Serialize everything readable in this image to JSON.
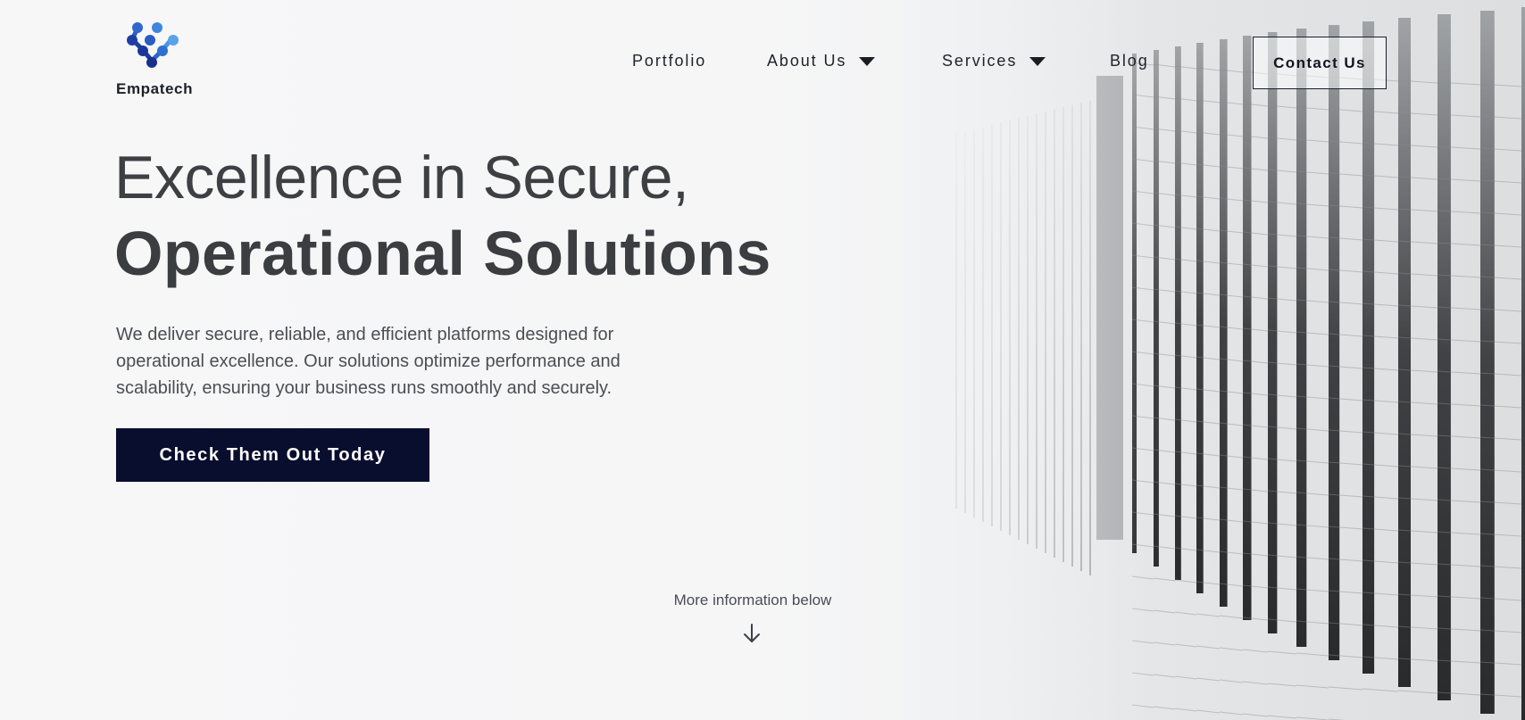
{
  "brand": {
    "name": "Empatech",
    "logo_icon": "molecule-logo-icon",
    "colors": [
      "#1f3fa8",
      "#2b72d1",
      "#4d9be6"
    ]
  },
  "nav": {
    "items": [
      {
        "label": "Portfolio",
        "has_dropdown": false
      },
      {
        "label": "About Us",
        "has_dropdown": true
      },
      {
        "label": "Services",
        "has_dropdown": true
      },
      {
        "label": "Blog",
        "has_dropdown": false
      }
    ],
    "contact_label": "Contact Us"
  },
  "hero": {
    "headline_line1": "Excellence in Secure,",
    "headline_line2": "Operational Solutions",
    "description": "We deliver secure, reliable, and efficient platforms designed for operational excellence. Our solutions optimize performance and scalability, ensuring your business runs smoothly and securely.",
    "cta_label": "Check Them Out Today",
    "more_info": "More information below",
    "cta_color": "#0a0e2e"
  }
}
